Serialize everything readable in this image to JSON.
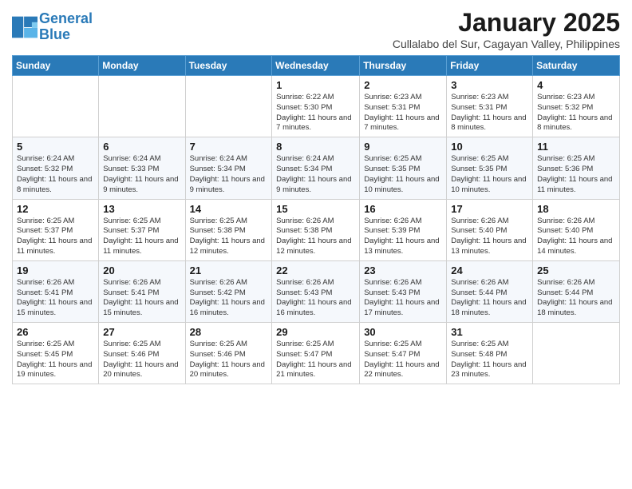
{
  "header": {
    "logo_line1": "General",
    "logo_line2": "Blue",
    "month_title": "January 2025",
    "subtitle": "Cullalabo del Sur, Cagayan Valley, Philippines"
  },
  "days_of_week": [
    "Sunday",
    "Monday",
    "Tuesday",
    "Wednesday",
    "Thursday",
    "Friday",
    "Saturday"
  ],
  "weeks": [
    [
      {
        "day": "",
        "info": ""
      },
      {
        "day": "",
        "info": ""
      },
      {
        "day": "",
        "info": ""
      },
      {
        "day": "1",
        "info": "Sunrise: 6:22 AM\nSunset: 5:30 PM\nDaylight: 11 hours and 7 minutes."
      },
      {
        "day": "2",
        "info": "Sunrise: 6:23 AM\nSunset: 5:31 PM\nDaylight: 11 hours and 7 minutes."
      },
      {
        "day": "3",
        "info": "Sunrise: 6:23 AM\nSunset: 5:31 PM\nDaylight: 11 hours and 8 minutes."
      },
      {
        "day": "4",
        "info": "Sunrise: 6:23 AM\nSunset: 5:32 PM\nDaylight: 11 hours and 8 minutes."
      }
    ],
    [
      {
        "day": "5",
        "info": "Sunrise: 6:24 AM\nSunset: 5:32 PM\nDaylight: 11 hours and 8 minutes."
      },
      {
        "day": "6",
        "info": "Sunrise: 6:24 AM\nSunset: 5:33 PM\nDaylight: 11 hours and 9 minutes."
      },
      {
        "day": "7",
        "info": "Sunrise: 6:24 AM\nSunset: 5:34 PM\nDaylight: 11 hours and 9 minutes."
      },
      {
        "day": "8",
        "info": "Sunrise: 6:24 AM\nSunset: 5:34 PM\nDaylight: 11 hours and 9 minutes."
      },
      {
        "day": "9",
        "info": "Sunrise: 6:25 AM\nSunset: 5:35 PM\nDaylight: 11 hours and 10 minutes."
      },
      {
        "day": "10",
        "info": "Sunrise: 6:25 AM\nSunset: 5:35 PM\nDaylight: 11 hours and 10 minutes."
      },
      {
        "day": "11",
        "info": "Sunrise: 6:25 AM\nSunset: 5:36 PM\nDaylight: 11 hours and 11 minutes."
      }
    ],
    [
      {
        "day": "12",
        "info": "Sunrise: 6:25 AM\nSunset: 5:37 PM\nDaylight: 11 hours and 11 minutes."
      },
      {
        "day": "13",
        "info": "Sunrise: 6:25 AM\nSunset: 5:37 PM\nDaylight: 11 hours and 11 minutes."
      },
      {
        "day": "14",
        "info": "Sunrise: 6:25 AM\nSunset: 5:38 PM\nDaylight: 11 hours and 12 minutes."
      },
      {
        "day": "15",
        "info": "Sunrise: 6:26 AM\nSunset: 5:38 PM\nDaylight: 11 hours and 12 minutes."
      },
      {
        "day": "16",
        "info": "Sunrise: 6:26 AM\nSunset: 5:39 PM\nDaylight: 11 hours and 13 minutes."
      },
      {
        "day": "17",
        "info": "Sunrise: 6:26 AM\nSunset: 5:40 PM\nDaylight: 11 hours and 13 minutes."
      },
      {
        "day": "18",
        "info": "Sunrise: 6:26 AM\nSunset: 5:40 PM\nDaylight: 11 hours and 14 minutes."
      }
    ],
    [
      {
        "day": "19",
        "info": "Sunrise: 6:26 AM\nSunset: 5:41 PM\nDaylight: 11 hours and 15 minutes."
      },
      {
        "day": "20",
        "info": "Sunrise: 6:26 AM\nSunset: 5:41 PM\nDaylight: 11 hours and 15 minutes."
      },
      {
        "day": "21",
        "info": "Sunrise: 6:26 AM\nSunset: 5:42 PM\nDaylight: 11 hours and 16 minutes."
      },
      {
        "day": "22",
        "info": "Sunrise: 6:26 AM\nSunset: 5:43 PM\nDaylight: 11 hours and 16 minutes."
      },
      {
        "day": "23",
        "info": "Sunrise: 6:26 AM\nSunset: 5:43 PM\nDaylight: 11 hours and 17 minutes."
      },
      {
        "day": "24",
        "info": "Sunrise: 6:26 AM\nSunset: 5:44 PM\nDaylight: 11 hours and 18 minutes."
      },
      {
        "day": "25",
        "info": "Sunrise: 6:26 AM\nSunset: 5:44 PM\nDaylight: 11 hours and 18 minutes."
      }
    ],
    [
      {
        "day": "26",
        "info": "Sunrise: 6:25 AM\nSunset: 5:45 PM\nDaylight: 11 hours and 19 minutes."
      },
      {
        "day": "27",
        "info": "Sunrise: 6:25 AM\nSunset: 5:46 PM\nDaylight: 11 hours and 20 minutes."
      },
      {
        "day": "28",
        "info": "Sunrise: 6:25 AM\nSunset: 5:46 PM\nDaylight: 11 hours and 20 minutes."
      },
      {
        "day": "29",
        "info": "Sunrise: 6:25 AM\nSunset: 5:47 PM\nDaylight: 11 hours and 21 minutes."
      },
      {
        "day": "30",
        "info": "Sunrise: 6:25 AM\nSunset: 5:47 PM\nDaylight: 11 hours and 22 minutes."
      },
      {
        "day": "31",
        "info": "Sunrise: 6:25 AM\nSunset: 5:48 PM\nDaylight: 11 hours and 23 minutes."
      },
      {
        "day": "",
        "info": ""
      }
    ]
  ]
}
